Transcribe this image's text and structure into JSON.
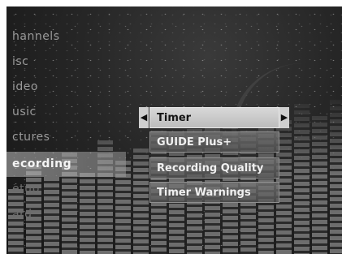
{
  "left_menu": {
    "items": [
      {
        "label": "hannels"
      },
      {
        "label": "isc"
      },
      {
        "label": "ideo"
      },
      {
        "label": "usic"
      },
      {
        "label": "ctures"
      },
      {
        "label": "ecording"
      },
      {
        "label": "etup"
      },
      {
        "label": "ard"
      }
    ],
    "selected_index": 5
  },
  "submenu": {
    "items": [
      {
        "label": "Timer"
      },
      {
        "label": "GUIDE Plus+"
      },
      {
        "label": "Recording Quality"
      },
      {
        "label": "Timer Warnings"
      }
    ],
    "selected_index": 0,
    "prev_arrow": "left-triangle-icon",
    "next_arrow": "right-triangle-icon"
  }
}
